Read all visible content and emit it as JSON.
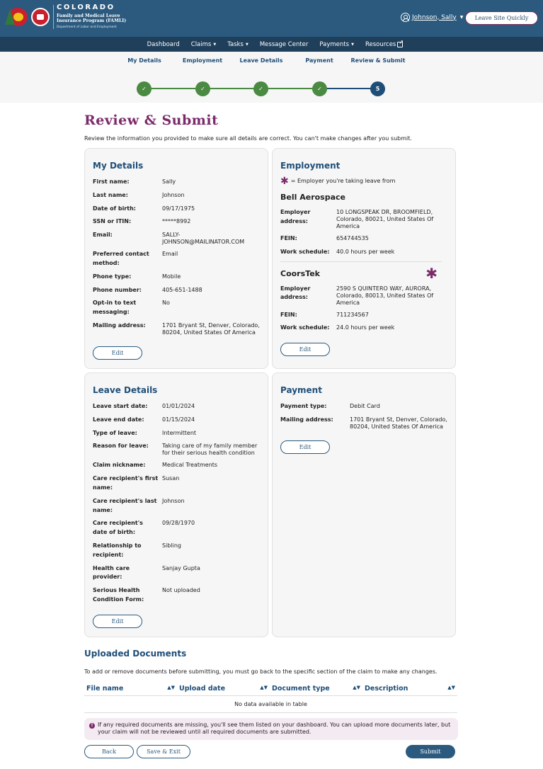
{
  "header": {
    "logo": {
      "state": "COLORADO",
      "program_line1": "Family and Medical Leave",
      "program_line2": "Insurance Program (FAMLI)",
      "department": "Department of Labor and Employment"
    },
    "user_name": "Johnson, Sally",
    "leave_site_label": "Leave Site Quickly"
  },
  "nav": [
    {
      "label": "Dashboard",
      "has_dropdown": false
    },
    {
      "label": "Claims",
      "has_dropdown": true
    },
    {
      "label": "Tasks",
      "has_dropdown": true
    },
    {
      "label": "Message Center",
      "has_dropdown": false
    },
    {
      "label": "Payments",
      "has_dropdown": true
    },
    {
      "label": "Resources",
      "has_dropdown": false,
      "external": true
    }
  ],
  "stepper": {
    "steps": [
      {
        "label": "My Details",
        "status": "complete"
      },
      {
        "label": "Employment",
        "status": "complete"
      },
      {
        "label": "Leave Details",
        "status": "complete"
      },
      {
        "label": "Payment",
        "status": "complete"
      },
      {
        "label": "Review & Submit",
        "status": "current",
        "number": "5"
      }
    ],
    "check_glyph": "✓"
  },
  "page": {
    "title": "Review & Submit",
    "intro": "Review the information you provided to make sure all details are correct. You can't make changes after you submit."
  },
  "my_details": {
    "title": "My Details",
    "rows": [
      {
        "label": "First name:",
        "value": "Sally"
      },
      {
        "label": "Last name:",
        "value": "Johnson"
      },
      {
        "label": "Date of birth:",
        "value": "09/17/1975"
      },
      {
        "label": "SSN or ITIN:",
        "value": "*****8992"
      },
      {
        "label": "Email:",
        "value": "SALLY-JOHNSON@MAILINATOR.COM"
      },
      {
        "label": "Preferred contact method:",
        "value": "Email"
      },
      {
        "label": "Phone type:",
        "value": "Mobile"
      },
      {
        "label": "Phone number:",
        "value": "405-651-1488"
      },
      {
        "label": "Opt-in to text messaging:",
        "value": "No"
      },
      {
        "label": "Mailing address:",
        "value": "1701 Bryant St, Denver, Colorado, 80204, United States Of America"
      }
    ],
    "edit_label": "Edit"
  },
  "employment": {
    "title": "Employment",
    "legend": "= Employer you're taking leave from",
    "employers": [
      {
        "name": "Bell Aerospace",
        "taking_leave_from": false,
        "rows": [
          {
            "label": "Employer address:",
            "value": "10 LONGSPEAK DR, BROOMFIELD, Colorado, 80021, United States Of America"
          },
          {
            "label": "FEIN:",
            "value": "654744535"
          },
          {
            "label": "Work schedule:",
            "value": "40.0 hours per week"
          }
        ]
      },
      {
        "name": "CoorsTek",
        "taking_leave_from": true,
        "rows": [
          {
            "label": "Employer address:",
            "value": "2590 S QUINTERO WAY, AURORA, Colorado, 80013, United States Of America"
          },
          {
            "label": "FEIN:",
            "value": "711234567"
          },
          {
            "label": "Work schedule:",
            "value": "24.0 hours per week"
          }
        ]
      }
    ],
    "edit_label": "Edit"
  },
  "leave_details": {
    "title": "Leave Details",
    "rows": [
      {
        "label": "Leave start date:",
        "value": "01/01/2024"
      },
      {
        "label": "Leave end date:",
        "value": "01/15/2024"
      },
      {
        "label": "Type of leave:",
        "value": "Intermittent"
      },
      {
        "label": "Reason for leave:",
        "value": "Taking care of my family member for their serious health condition"
      },
      {
        "label": "Claim nickname:",
        "value": "Medical Treatments"
      },
      {
        "label": "Care recipient's first name:",
        "value": "Susan"
      },
      {
        "label": "Care recipient's last name:",
        "value": "Johnson"
      },
      {
        "label": "Care recipient's date of birth:",
        "value": "09/28/1970"
      },
      {
        "label": "Relationship to recipient:",
        "value": "Sibling"
      },
      {
        "label": "Health care provider:",
        "value": "Sanjay Gupta"
      },
      {
        "label": "Serious Health Condition Form:",
        "value": "Not uploaded"
      }
    ],
    "edit_label": "Edit"
  },
  "payment": {
    "title": "Payment",
    "rows": [
      {
        "label": "Payment type:",
        "value": "Debit Card"
      },
      {
        "label": "Mailing address:",
        "value": "1701 Bryant St, Denver, Colorado, 80204, United States Of America"
      }
    ],
    "edit_label": "Edit"
  },
  "documents": {
    "title": "Uploaded Documents",
    "note": "To add or remove documents before submitting, you must go back to the specific section of the claim to make any changes.",
    "columns": [
      "File name",
      "Upload date",
      "Document type",
      "Description"
    ],
    "empty_text": "No data available in table",
    "alert": "If any required documents are missing, you'll see them listed on your dashboard. You can upload more documents later, but your claim will not be reviewed until all required documents are submitted."
  },
  "footer": {
    "back_label": "Back",
    "save_exit_label": "Save & Exit",
    "submit_label": "Submit"
  },
  "colors": {
    "header_bg": "#2b5a7e",
    "nav_bg": "#1f3f5b",
    "complete_step": "#4a8a42",
    "current_step": "#1e4e78",
    "title_purple": "#7b2a6a",
    "heading_blue": "#1e4e78"
  }
}
